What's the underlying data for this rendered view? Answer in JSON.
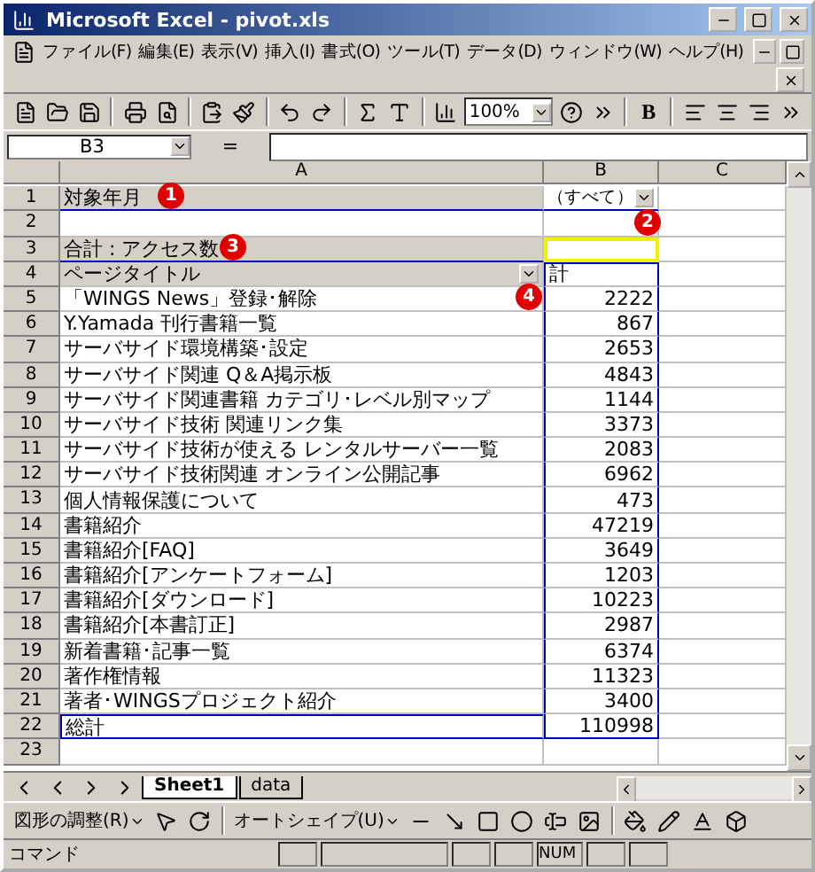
{
  "window": {
    "title": "Microsoft Excel - pivot.xls"
  },
  "menu": {
    "items": [
      "ファイル(F)",
      "編集(E)",
      "表示(V)",
      "挿入(I)",
      "書式(O)",
      "ツール(T)",
      "データ(D)",
      "ウィンドウ(W)",
      "ヘルプ(H)"
    ]
  },
  "toolbar": {
    "zoom": "100%",
    "bold": "B"
  },
  "formula_bar": {
    "name_box": "B3",
    "equals": "="
  },
  "columns": [
    "A",
    "B",
    "C"
  ],
  "rows": [
    {
      "number": "1",
      "kind": "page_field",
      "a": "対象年月",
      "b": "（すべて）",
      "selected": false
    },
    {
      "number": "2",
      "kind": "blank",
      "selected": false
    },
    {
      "number": "3",
      "kind": "data_field",
      "a": "合計 : アクセス数",
      "selected": true
    },
    {
      "number": "4",
      "kind": "row_field",
      "a": "ページタイトル",
      "b": "計",
      "selected": false
    },
    {
      "number": "5",
      "kind": "item",
      "a": "「WINGS News」登録･解除",
      "b": "2222",
      "selected": false
    },
    {
      "number": "6",
      "kind": "item",
      "a": "Y.Yamada 刊行書籍一覧",
      "b": "867",
      "selected": false
    },
    {
      "number": "7",
      "kind": "item",
      "a": "サーバサイド環境構築･設定",
      "b": "2653",
      "selected": false
    },
    {
      "number": "8",
      "kind": "item",
      "a": "サーバサイド関連 Q＆A掲示板",
      "b": "4843",
      "selected": false
    },
    {
      "number": "9",
      "kind": "item",
      "a": "サーバサイド関連書籍 カテゴリ･レベル別マップ",
      "b": "1144",
      "selected": false
    },
    {
      "number": "10",
      "kind": "item",
      "a": "サーバサイド技術 関連リンク集",
      "b": "3373",
      "selected": false
    },
    {
      "number": "11",
      "kind": "item",
      "a": "サーバサイド技術が使える レンタルサーバー一覧",
      "b": "2083",
      "selected": false
    },
    {
      "number": "12",
      "kind": "item",
      "a": "サーバサイド技術関連 オンライン公開記事",
      "b": "6962",
      "selected": false
    },
    {
      "number": "13",
      "kind": "item",
      "a": "個人情報保護について",
      "b": "473",
      "selected": false
    },
    {
      "number": "14",
      "kind": "item",
      "a": "書籍紹介",
      "b": "47219",
      "selected": false
    },
    {
      "number": "15",
      "kind": "item",
      "a": "書籍紹介[FAQ]",
      "b": "3649",
      "selected": false
    },
    {
      "number": "16",
      "kind": "item",
      "a": "書籍紹介[アンケートフォーム]",
      "b": "1203",
      "selected": false
    },
    {
      "number": "17",
      "kind": "item",
      "a": "書籍紹介[ダウンロード]",
      "b": "10223",
      "selected": false
    },
    {
      "number": "18",
      "kind": "item",
      "a": "書籍紹介[本書訂正]",
      "b": "2987",
      "selected": false
    },
    {
      "number": "19",
      "kind": "item",
      "a": "新着書籍･記事一覧",
      "b": "6374",
      "selected": false
    },
    {
      "number": "20",
      "kind": "item",
      "a": "著作権情報",
      "b": "11323",
      "selected": false
    },
    {
      "number": "21",
      "kind": "item",
      "a": "著者･WINGSプロジェクト紹介",
      "b": "3400",
      "selected": false
    },
    {
      "number": "22",
      "kind": "total",
      "a": "総計",
      "b": "110998",
      "selected": false
    },
    {
      "number": "23",
      "kind": "blank",
      "selected": false
    }
  ],
  "callouts": [
    "1",
    "2",
    "3",
    "4"
  ],
  "sheet_tabs": [
    {
      "label": "Sheet1",
      "selected": true
    },
    {
      "label": "data",
      "selected": false
    }
  ],
  "drawing_toolbar": {
    "draw_menu": "図形の調整(R)",
    "autoshapes": "オートシェイプ(U)"
  },
  "status_bar": {
    "mode": "コマンド",
    "num": "NUM"
  }
}
